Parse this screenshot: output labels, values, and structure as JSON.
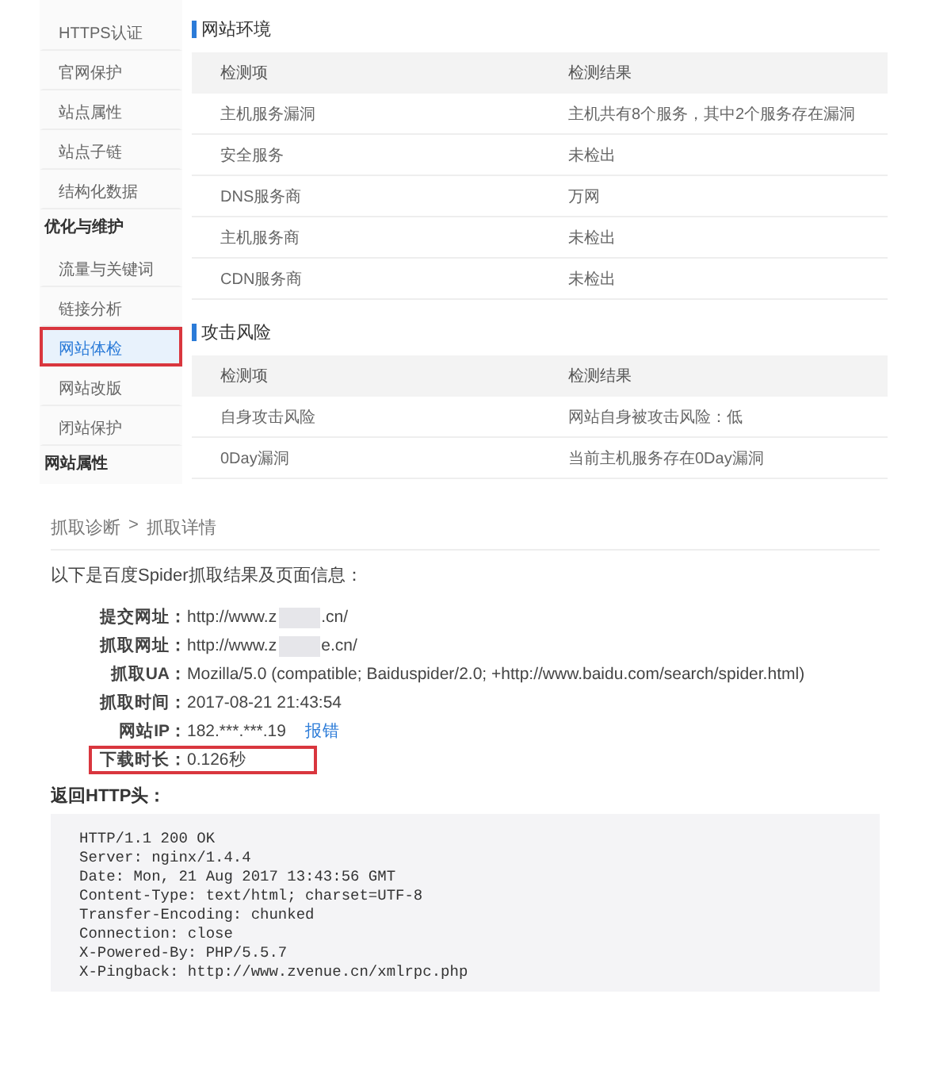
{
  "sidebar": {
    "items": [
      {
        "kind": "item",
        "label": "HTTPS认证",
        "selected": false,
        "highlighted": false
      },
      {
        "kind": "item",
        "label": "官网保护",
        "selected": false,
        "highlighted": false
      },
      {
        "kind": "item",
        "label": "站点属性",
        "selected": false,
        "highlighted": false
      },
      {
        "kind": "item",
        "label": "站点子链",
        "selected": false,
        "highlighted": false
      },
      {
        "kind": "item",
        "label": "结构化数据",
        "selected": false,
        "highlighted": false
      },
      {
        "kind": "heading",
        "label": "优化与维护"
      },
      {
        "kind": "item",
        "label": "流量与关键词",
        "selected": false,
        "highlighted": false
      },
      {
        "kind": "item",
        "label": "链接分析",
        "selected": false,
        "highlighted": false
      },
      {
        "kind": "item",
        "label": "网站体检",
        "selected": true,
        "highlighted": true
      },
      {
        "kind": "item",
        "label": "网站改版",
        "selected": false,
        "highlighted": false
      },
      {
        "kind": "item",
        "label": "闭站保护",
        "selected": false,
        "highlighted": false
      },
      {
        "kind": "heading",
        "label": "网站属性"
      }
    ]
  },
  "sections": [
    {
      "title": "网站环境",
      "columns": [
        "检测项",
        "检测结果"
      ],
      "rows": [
        [
          "主机服务漏洞",
          "主机共有8个服务，其中2个服务存在漏洞"
        ],
        [
          "安全服务",
          "未检出"
        ],
        [
          "DNS服务商",
          "万网"
        ],
        [
          "主机服务商",
          "未检出"
        ],
        [
          "CDN服务商",
          "未检出"
        ]
      ]
    },
    {
      "title": "攻击风险",
      "columns": [
        "检测项",
        "检测结果"
      ],
      "rows": [
        [
          "自身攻击风险",
          "网站自身被攻击风险：低"
        ],
        [
          "0Day漏洞",
          "当前主机服务存在0Day漏洞"
        ]
      ]
    }
  ],
  "crawl": {
    "breadcrumb": [
      {
        "label": "抓取诊断"
      },
      {
        "label": ">"
      },
      {
        "label": "抓取详情"
      }
    ],
    "intro": "以下是百度Spider抓取结果及页面信息：",
    "info": [
      {
        "label": "提交网址：",
        "value": "http://www.z",
        "value_end": ".cn/",
        "redacted": true,
        "highlighted": false
      },
      {
        "label": "抓取网址：",
        "value": "http://www.z",
        "value_end": "e.cn/",
        "redacted": true,
        "highlighted": false
      },
      {
        "label": "抓取UA：",
        "value": "Mozilla/5.0 (compatible; Baiduspider/2.0; +http://www.baidu.com/search/spider.html)",
        "redacted": false,
        "highlighted": false
      },
      {
        "label": "抓取时间：",
        "value": "2017-08-21 21:43:54",
        "redacted": false,
        "highlighted": false
      },
      {
        "label": "网站IP：",
        "value": "182.***.***.19",
        "link": "报错",
        "redacted": false,
        "highlighted": false
      },
      {
        "label": "下载时长：",
        "value": "0.126秒",
        "redacted": false,
        "highlighted": true
      }
    ],
    "headers_title": "返回HTTP头：",
    "headers": [
      "HTTP/1.1 200 OK",
      "Server: nginx/1.4.4",
      "Date: Mon, 21 Aug 2017 13:43:56 GMT",
      "Content-Type: text/html; charset=UTF-8",
      "Transfer-Encoding: chunked",
      "Connection: close",
      "X-Powered-By: PHP/5.5.7",
      "X-Pingback: http://www.zvenue.cn/xmlrpc.php"
    ]
  }
}
